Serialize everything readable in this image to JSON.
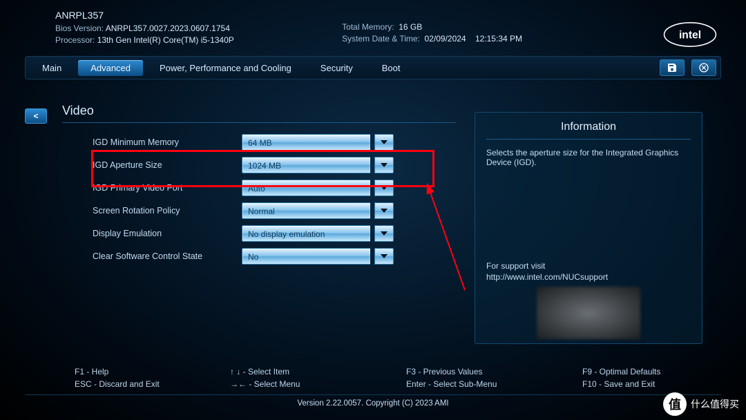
{
  "header": {
    "model": "ANRPL357",
    "bios_label": "Bios Version:",
    "bios_value": "ANRPL357.0027.2023.0607.1754",
    "cpu_label": "Processor:",
    "cpu_value": "13th Gen Intel(R) Core(TM) i5-1340P",
    "mem_label": "Total Memory:",
    "mem_value": "16 GB",
    "dt_label": "System Date & Time:",
    "dt_date": "02/09/2024",
    "dt_time": "12:15:34 PM"
  },
  "tabs": {
    "t0": "Main",
    "t1": "Advanced",
    "t2": "Power, Performance and Cooling",
    "t3": "Security",
    "t4": "Boot"
  },
  "back": "<",
  "section_title": "Video",
  "rows": {
    "r0": {
      "label": "IGD Minimum Memory",
      "value": "64 MB"
    },
    "r1": {
      "label": "IGD Aperture Size",
      "value": "1024 MB"
    },
    "r2": {
      "label": "IGD Primary Video Port",
      "value": "Auto"
    },
    "r3": {
      "label": "Screen Rotation Policy",
      "value": "Normal"
    },
    "r4": {
      "label": "Display Emulation",
      "value": "No display emulation"
    },
    "r5": {
      "label": "Clear Software Control State",
      "value": "No"
    }
  },
  "info": {
    "title": "Information",
    "desc": "Selects the aperture size for the Integrated Graphics Device (IGD).",
    "support1": "For support visit",
    "support2": "http://www.intel.com/NUCsupport"
  },
  "footer": {
    "f1a": "F1 - Help",
    "f1b": "ESC - Discard and Exit",
    "f2a": "↑ ↓ - Select Item",
    "f2b": "→← - Select Menu",
    "f3a": "F3 - Previous Values",
    "f3b": "Enter - Select Sub-Menu",
    "f4a": "F9 - Optimal Defaults",
    "f4b": "F10 - Save and Exit",
    "copyright": "Version 2.22.0057. Copyright (C) 2023 AMI"
  },
  "watermark": "什么值得买"
}
